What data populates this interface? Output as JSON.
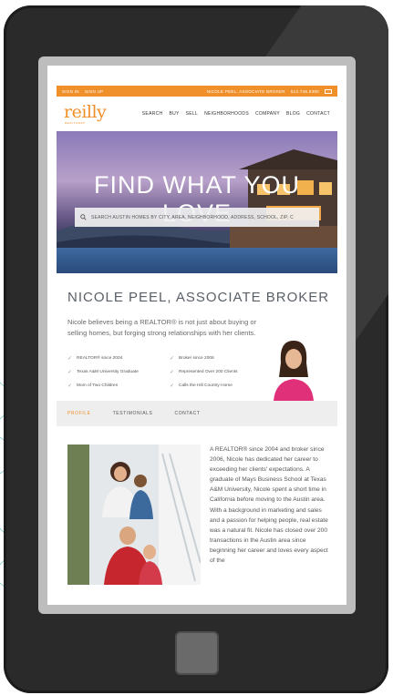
{
  "topbar": {
    "sign_in": "SIGN IN",
    "sign_up": "SIGN UP",
    "agent": "NICOLE PEEL, ASSOCIATE BROKER",
    "phone": "512.746.0390"
  },
  "brand": {
    "logo": "reilly",
    "sub": "REALTORS®"
  },
  "nav": [
    "SEARCH",
    "BUY",
    "SELL",
    "NEIGHBORHOODS",
    "COMPANY",
    "BLOG",
    "CONTACT"
  ],
  "hero": {
    "title": "FIND WHAT YOU LOVE",
    "search_placeholder": "SEARCH AUSTIN HOMES BY CITY, AREA, NEIGHBORHOOD, ADDRESS, SCHOOL, ZIP, C"
  },
  "profile": {
    "name": "NICOLE PEEL, ASSOCIATE BROKER",
    "bio": "Nicole believes being a REALTOR® is not just about buying or selling homes, but forging strong relationships with her clients.",
    "facts": [
      "REALTOR® since 2004",
      "Broker since 2006",
      "Texas A&M University Graduate",
      "Represented Over 200 Clients",
      "Mom of Two Children",
      "Calls the Hill Country Home"
    ]
  },
  "tabs": [
    "PROFILE",
    "TESTIMONIALS",
    "CONTACT"
  ],
  "about": "A REALTOR® since 2004 and broker since 2006, Nicole has dedicated her career to exceeding her clients' expectations. A graduate of Mays Business School at Texas A&M University, Nicole spent a short time in California before moving to the Austin area. With a background in marketing and sales and a passion for helping people, real estate was a natural fit. Nicole has closed over 200 transactions in the Austin area since beginning her career and loves every aspect of the",
  "colors": {
    "accent": "#f0902a",
    "device": "#2a2a2a"
  }
}
